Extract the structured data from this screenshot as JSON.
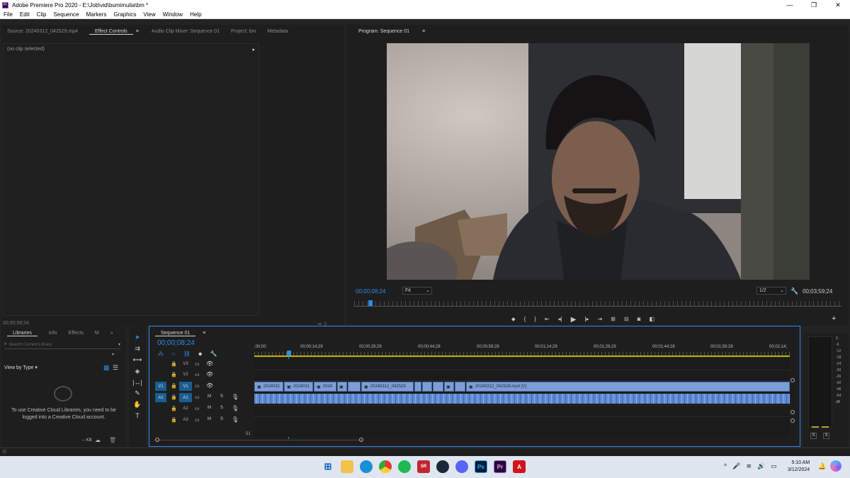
{
  "window": {
    "title": "Adobe Premiere Pro 2020 - E:\\Job\\vid\\bumimulia\\bm *",
    "minimize": "—",
    "maximize": "❐",
    "close": "✕"
  },
  "menu": [
    "File",
    "Edit",
    "Clip",
    "Sequence",
    "Markers",
    "Graphics",
    "View",
    "Window",
    "Help"
  ],
  "source_panel": {
    "tabs": [
      "Source: 20240312_042529.mp4",
      "Effect Controls",
      "Audio Clip Mixer: Sequence 01",
      "Project: bm",
      "Metadata"
    ],
    "active_tab": "Effect Controls",
    "no_clip": "(no clip selected)",
    "timecode": "00;00;08;24"
  },
  "program_monitor": {
    "title": "Program: Sequence 01",
    "timecode": "00;00;08;24",
    "fit": "Fit",
    "resolution": "1/2",
    "duration": "00;03;59;24"
  },
  "libraries": {
    "tabs": [
      "Libraries",
      "Info",
      "Effects",
      "M"
    ],
    "search_placeholder": "Search Current Library",
    "view_by": "View by Type",
    "message": "To use Creative Cloud Libraries, you need to be logged into a Creative Cloud account.",
    "kb": "-- KB"
  },
  "timeline": {
    "title": "Sequence 01",
    "timecode": "00;00;08;24",
    "ruler": [
      ";00;00",
      "00;00;14;29",
      "00;00;29;29",
      "00;00;44;28",
      "00;00;59;28",
      "00;01;14;29",
      "00;01;29;29",
      "00;01;44;28",
      "00;01;59;28",
      "00;02;14;"
    ],
    "tracks_video": [
      {
        "src": "",
        "name": "V3"
      },
      {
        "src": "",
        "name": "V2"
      },
      {
        "src": "V1",
        "name": "V1"
      }
    ],
    "tracks_audio": [
      {
        "src": "A1",
        "name": "A1"
      },
      {
        "src": "",
        "name": "A2"
      },
      {
        "src": "",
        "name": "A3"
      }
    ],
    "m_label": "M",
    "s_label": "S",
    "clip_labels": [
      "2024031",
      "2024031",
      "2024",
      "20240312_042529",
      "20240312_042529.mp4 [V]"
    ],
    "bottom_num": "51"
  },
  "meter": {
    "scale": [
      "0",
      "-6",
      "-12",
      "-18",
      "-24",
      "-30",
      "-36",
      "-42",
      "-48",
      "-54",
      "dB"
    ],
    "solo": [
      "S",
      "S"
    ]
  },
  "taskbar": {
    "time": "5:10 AM",
    "date": "3/12/2024",
    "icons": [
      "windows-start-icon",
      "file-explorer-icon",
      "edge-icon",
      "chrome-icon",
      "spotify-icon",
      "screenrec-icon",
      "steam-icon",
      "discord-icon",
      "photoshop-icon",
      "premiere-icon",
      "acrobat-icon"
    ]
  },
  "colors": {
    "accent": "#2d8ceb",
    "clip_video": "#7c9ed6",
    "clip_audio": "#5f8ad2",
    "track_target": "#1b5d8e"
  }
}
